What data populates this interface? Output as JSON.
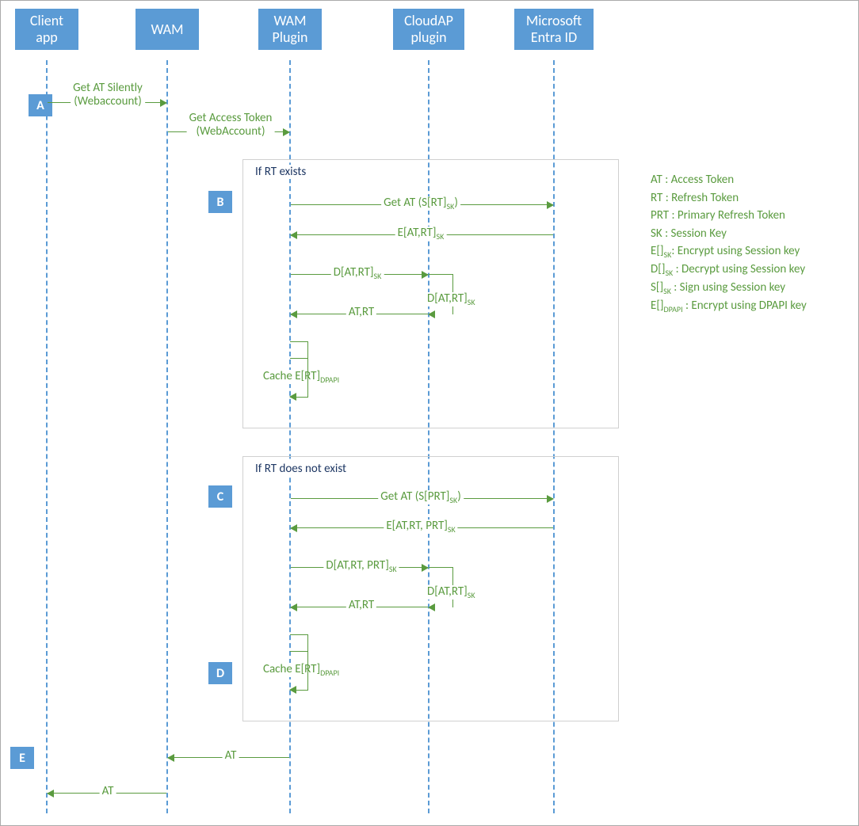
{
  "participants": {
    "client": "Client app",
    "wam": "WAM",
    "plugin": "WAM Plugin",
    "cloudap": "CloudAP plugin",
    "entra": "Microsoft Entra ID"
  },
  "steps": {
    "A": "A",
    "B": "B",
    "C": "C",
    "D": "D",
    "E": "E"
  },
  "fragments": {
    "rt_exists": "If RT exists",
    "rt_not_exists": "If RT does not exist"
  },
  "messages": {
    "m1_l1": "Get AT Silently",
    "m1_l2": "(Webaccount)",
    "m2_l1": "Get Access Token",
    "m2_l2": "(WebAccount)",
    "b_get_at": "Get AT (S[RT]_SK_)",
    "b_reply": "E[AT,RT]_SK_",
    "b_decrypt": "D[AT,RT]_SK_",
    "b_decrypt2": "D[AT,RT]_SK_",
    "b_at_rt": "AT,RT",
    "b_cache": "Cache E[RT]_DPAPI_",
    "c_get_at": "Get AT (S[PRT]_SK_)",
    "c_reply": "E[AT,RT, PRT]_SK_",
    "c_decrypt": "D[AT,RT, PRT]_SK_",
    "c_decrypt2": "D[AT,RT]_SK_",
    "c_at_rt": "AT,RT",
    "c_cache": "Cache E[RT]_DPAPI_",
    "ret_at_1": "AT",
    "ret_at_2": "AT"
  },
  "legend": [
    "AT : Access Token",
    "RT : Refresh Token",
    "PRT : Primary Refresh Token",
    "SK : Session Key",
    "E[]_SK_: Encrypt using Session key",
    "D[]_SK_ : Decrypt using Session key",
    "S[]_SK_ : Sign using Session key",
    "E[]_DPAPI_ : Encrypt using DPAPI key"
  ]
}
